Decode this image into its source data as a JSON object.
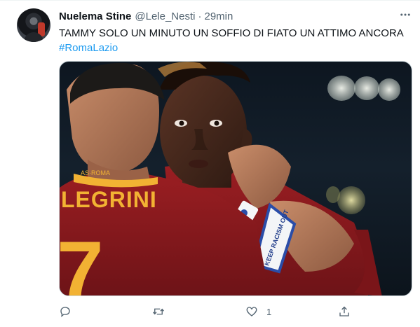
{
  "tweet": {
    "author_name": "Nuelema Stine",
    "handle": "@Lele_Nesti",
    "separator": "·",
    "time": "29min",
    "text_line1": "TAMMY SOLO UN MINUTO UN SOFFIO DI FIATO UN ATTIMO ANCORA",
    "hashtag": "#RomaLazio",
    "like_count": "1"
  },
  "media": {
    "jersey_name": "LEGRINI",
    "jersey_number": "7",
    "club_text": "AS·ROMA",
    "armband_text": "KEEP RACISM OUT"
  },
  "icons": {
    "more": "more-horizontal-icon",
    "reply": "reply-icon",
    "retweet": "retweet-icon",
    "like": "heart-icon",
    "share": "share-icon"
  },
  "colors": {
    "link": "#1d9bf0",
    "secondary_text": "#536471",
    "jersey": "#8a1a1f",
    "jersey_text": "#f2b233"
  }
}
